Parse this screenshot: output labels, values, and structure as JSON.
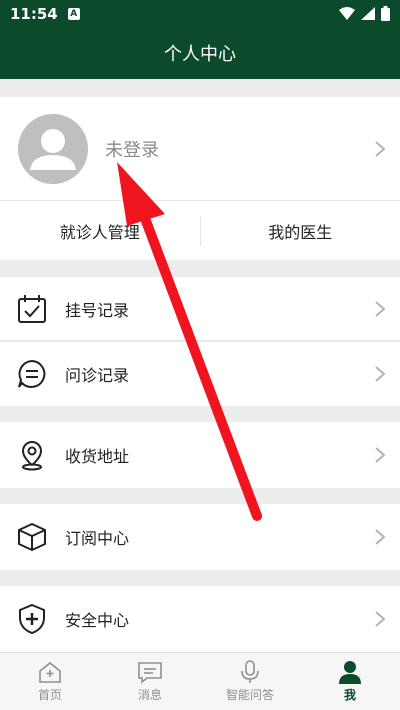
{
  "status": {
    "time": "11:54",
    "notif": "A"
  },
  "header": {
    "title": "个人中心"
  },
  "profile": {
    "name": "未登录"
  },
  "links": {
    "patients": "就诊人管理",
    "doctors": "我的医生"
  },
  "menu": [
    {
      "label": "挂号记录",
      "icon": "calendar-check-icon"
    },
    {
      "label": "问诊记录",
      "icon": "chat-bubble-icon"
    },
    {
      "label": "收货地址",
      "icon": "location-pin-icon"
    },
    {
      "label": "订阅中心",
      "icon": "box-icon"
    },
    {
      "label": "安全中心",
      "icon": "shield-plus-icon"
    }
  ],
  "tabs": [
    {
      "label": "首页",
      "icon": "home-icon"
    },
    {
      "label": "消息",
      "icon": "message-icon"
    },
    {
      "label": "智能问答",
      "icon": "microphone-icon"
    },
    {
      "label": "我",
      "icon": "person-icon"
    }
  ],
  "colors": {
    "primary": "#0b4a2a",
    "arrow": "#f0141e",
    "background": "#ececec"
  }
}
